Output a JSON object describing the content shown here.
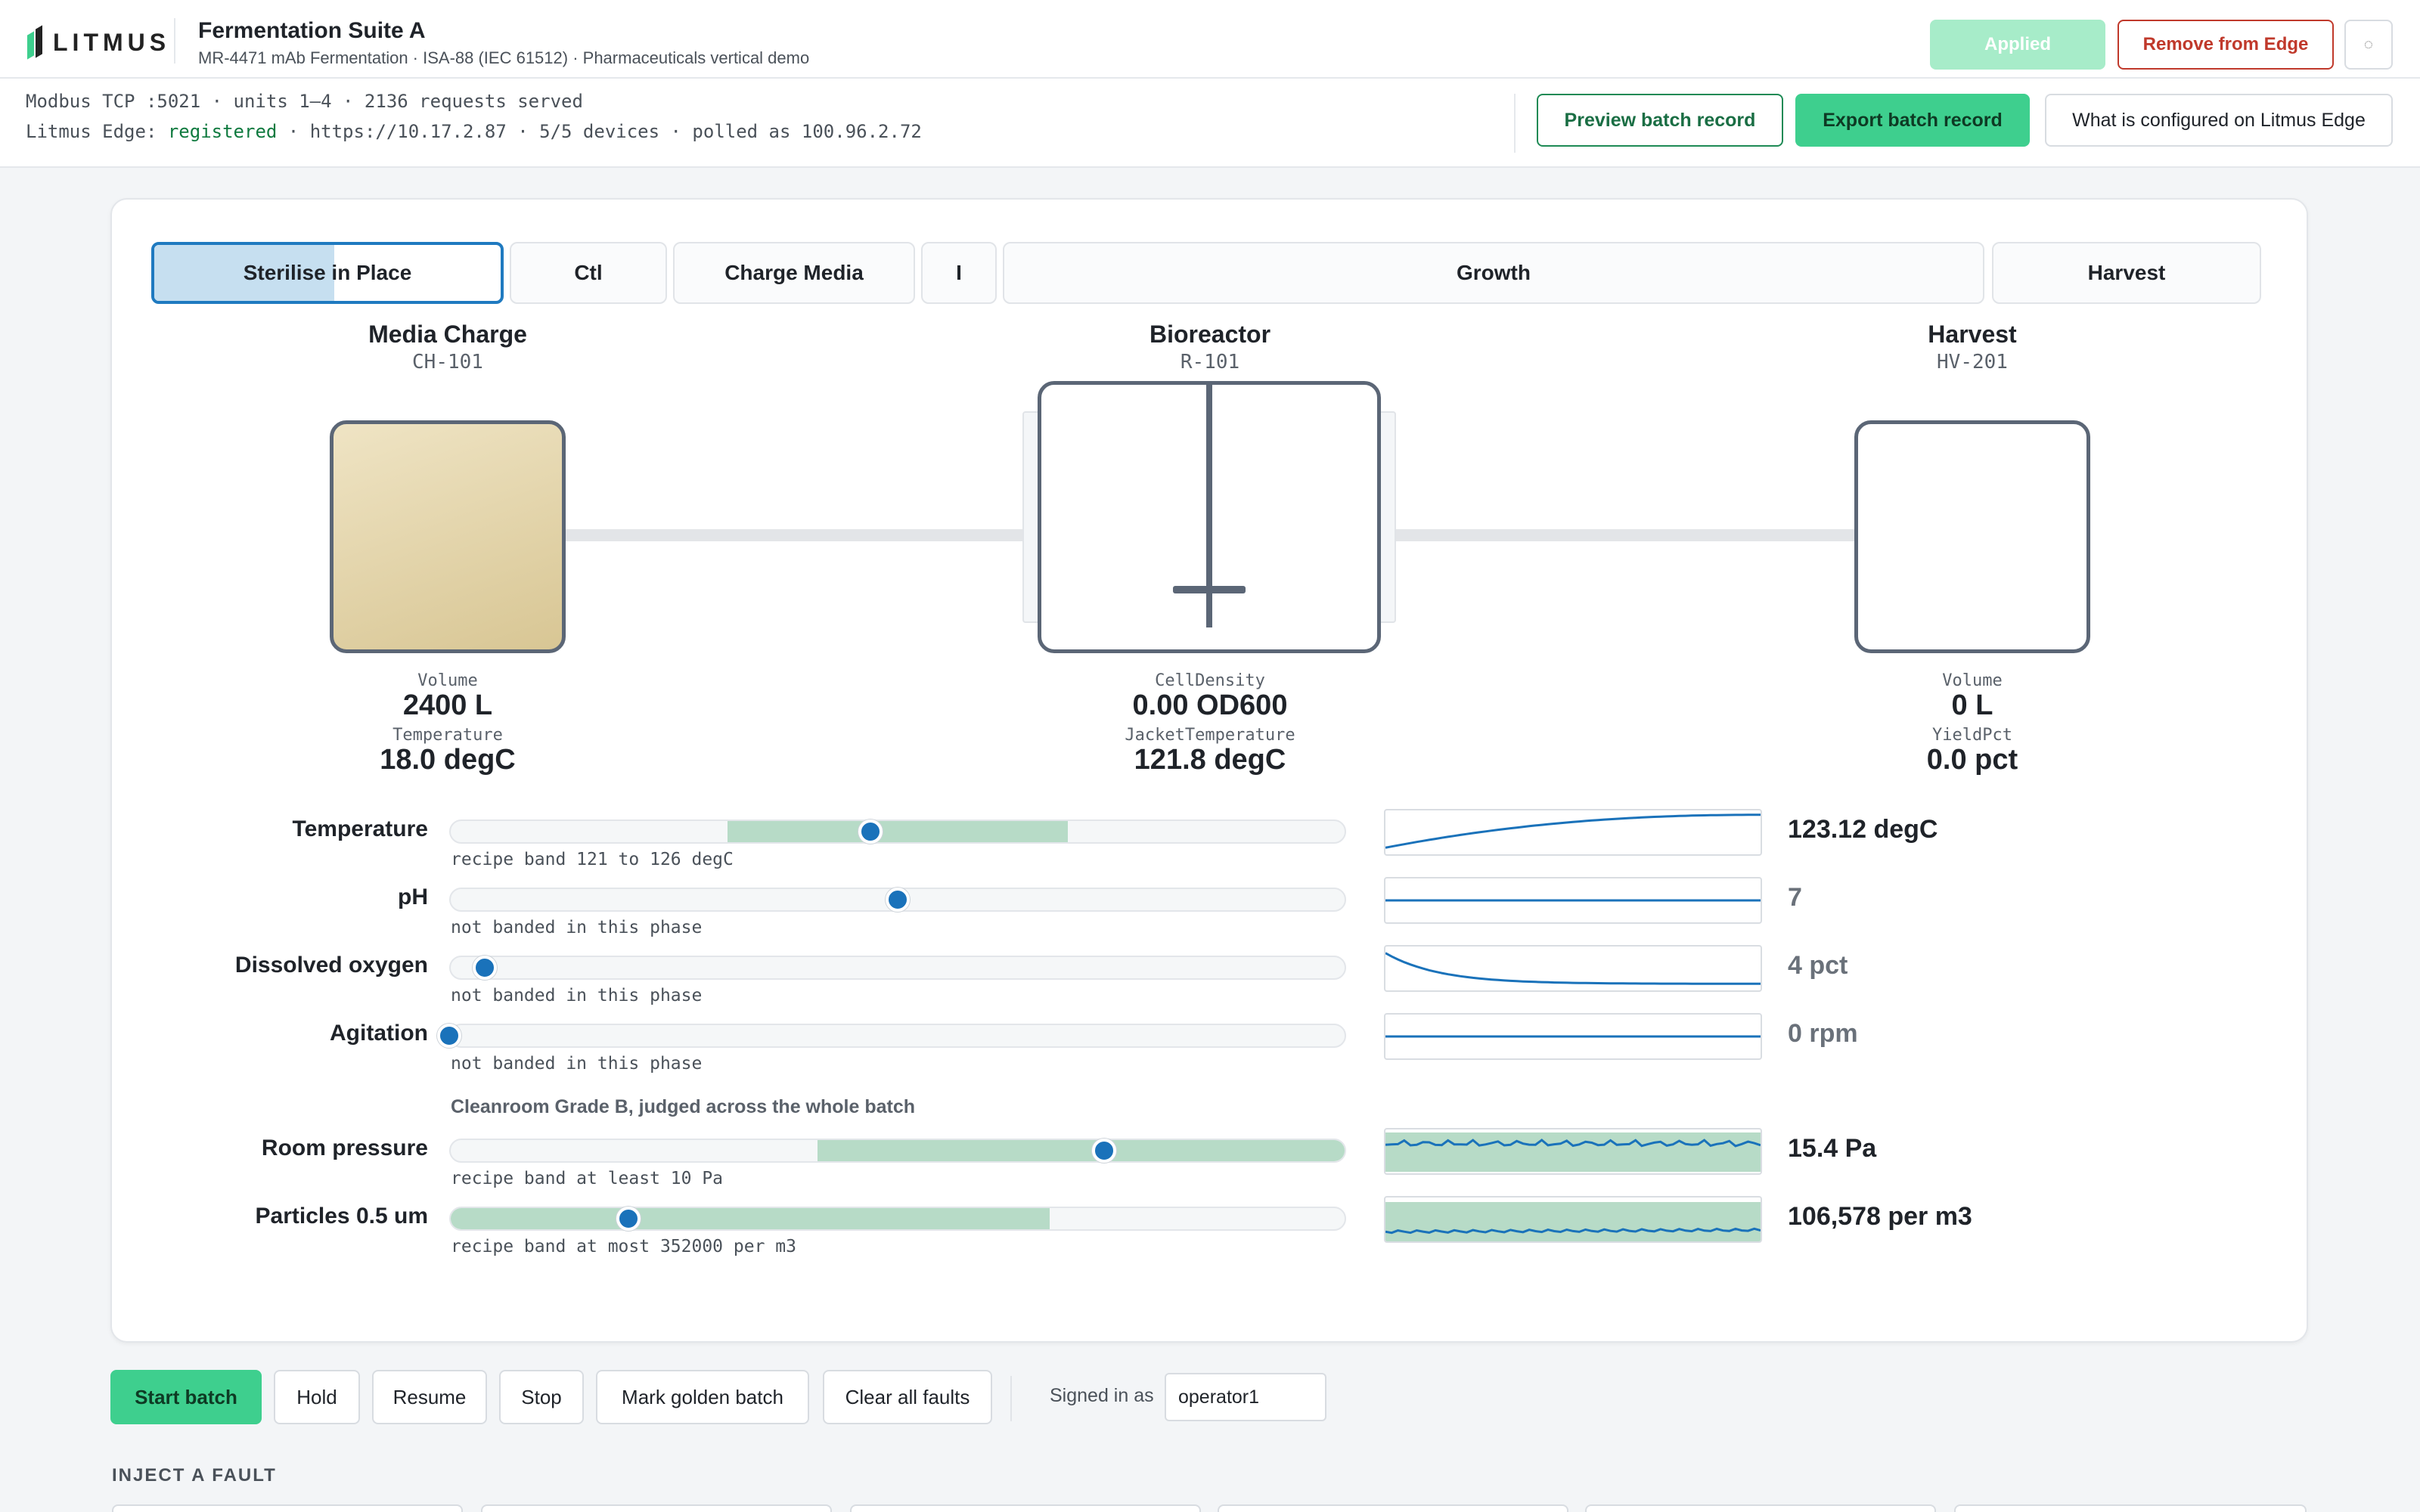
{
  "brand": {
    "logo_text": "LITMUS"
  },
  "header": {
    "title": "Fermentation Suite A",
    "subtitle": "MR-4471 mAb Fermentation · ISA-88 (IEC 61512) · Pharmaceuticals vertical demo",
    "applied_label": "Applied",
    "remove_label": "Remove from Edge",
    "small_glyph": "◌"
  },
  "status": {
    "line1": "Modbus TCP :5021 · units 1–4 · 2136 requests served",
    "line2_prefix": "Litmus Edge: ",
    "registered": "registered",
    "line2_suffix": " · https://10.17.2.87 · 5/5 devices · polled as 100.96.2.72"
  },
  "actions": {
    "preview_label": "Preview batch record",
    "export_label": "Export batch record",
    "what_label": "What is configured on Litmus Edge"
  },
  "phases": [
    {
      "label": "Sterilise in Place",
      "active": true,
      "progress": 0.52
    },
    {
      "label": "Ctl",
      "active": false
    },
    {
      "label": "Charge Media",
      "active": false
    },
    {
      "label": "I",
      "active": false
    },
    {
      "label": "Growth",
      "active": false
    },
    {
      "label": "Harvest",
      "active": false
    }
  ],
  "units": {
    "charge": {
      "name": "Media Charge",
      "tag": "CH-101",
      "label1": "Volume",
      "value1": "2400 L",
      "label2": "Temperature",
      "value2": "18.0 degC"
    },
    "reactor": {
      "name": "Bioreactor",
      "tag": "R-101",
      "label1": "CellDensity",
      "value1": "0.00 OD600",
      "label2": "JacketTemperature",
      "value2": "121.8 degC"
    },
    "harvest": {
      "name": "Harvest",
      "tag": "HV-201",
      "label1": "Volume",
      "value1": "0 L",
      "label2": "YieldPct",
      "value2": "0.0 pct"
    }
  },
  "parameters": [
    {
      "label": "Temperature",
      "note": "recipe band 121 to 126 degC",
      "reading": "123.12 degC",
      "position": 0.47,
      "band": [
        0.31,
        0.69
      ],
      "trend": "rise",
      "dim": false
    },
    {
      "label": "pH",
      "note": "not banded in this phase",
      "reading": "7",
      "position": 0.5,
      "band": null,
      "trend": "flat",
      "dim": true
    },
    {
      "label": "Dissolved oxygen",
      "note": "not banded in this phase",
      "reading": "4 pct",
      "position": 0.04,
      "band": null,
      "trend": "decay",
      "dim": true
    },
    {
      "label": "Agitation",
      "note": "not banded in this phase",
      "reading": "0 rpm",
      "position": 0.0,
      "band": null,
      "trend": "flat",
      "dim": true
    }
  ],
  "environment": {
    "title": "Cleanroom Grade B, judged across the whole batch",
    "items": [
      {
        "label": "Room pressure",
        "note": "recipe band at least 10 Pa",
        "reading": "15.4 Pa",
        "position": 0.73,
        "band": [
          0.41,
          1.0
        ],
        "trend": "noisy-high"
      },
      {
        "label": "Particles 0.5 um",
        "note": "recipe band at most 352000 per m3",
        "reading": "106,578 per m3",
        "position": 0.2,
        "band": [
          0.0,
          0.67
        ],
        "trend": "noisy-low"
      }
    ]
  },
  "controls": {
    "start": "Start batch",
    "hold": "Hold",
    "resume": "Resume",
    "stop": "Stop",
    "golden": "Mark golden batch",
    "clear": "Clear all faults",
    "signed_label": "Signed in as",
    "signed_value": "operator1"
  },
  "faults": {
    "title": "INJECT A FAULT"
  },
  "colors": {
    "accent": "#3ecf8e",
    "knob": "#1a72ba",
    "band": "#b7dbc7",
    "danger": "#c0392b",
    "trend_line": "#1a72ba"
  }
}
